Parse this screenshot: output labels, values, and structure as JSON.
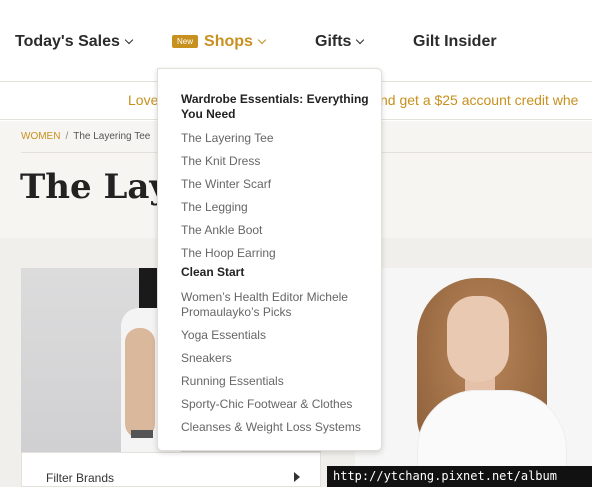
{
  "nav": {
    "items": [
      {
        "label": "Today's Sales"
      },
      {
        "badge": "New",
        "label": "Shops"
      },
      {
        "label": "Gifts"
      },
      {
        "label": "Gilt Insider"
      }
    ],
    "accent_color": "#c8901e"
  },
  "promo": {
    "left_text": "Love",
    "right_text": "nd get a $25 account credit whe"
  },
  "breadcrumb": {
    "root": "WOMEN",
    "separator": "/",
    "current": "The Layering Tee"
  },
  "page": {
    "title": "The Laye"
  },
  "filter": {
    "label": "Filter Brands"
  },
  "dropdown": {
    "sections": [
      {
        "heading": "Wardrobe Essentials: Everything You Need",
        "links": [
          "The Layering Tee",
          "The Knit Dress",
          "The Winter Scarf",
          "The Legging",
          "The Ankle Boot",
          "The Hoop Earring"
        ]
      },
      {
        "heading": "Clean Start",
        "links": [
          "Women’s Health Editor Michele Promaulayko’s Picks",
          "Yoga Essentials",
          "Sneakers",
          "Running Essentials",
          "Sporty-Chic Footwear & Clothes",
          "Cleanses & Weight Loss Systems"
        ]
      }
    ]
  },
  "watermark": "http://ytchang.pixnet.net/album"
}
